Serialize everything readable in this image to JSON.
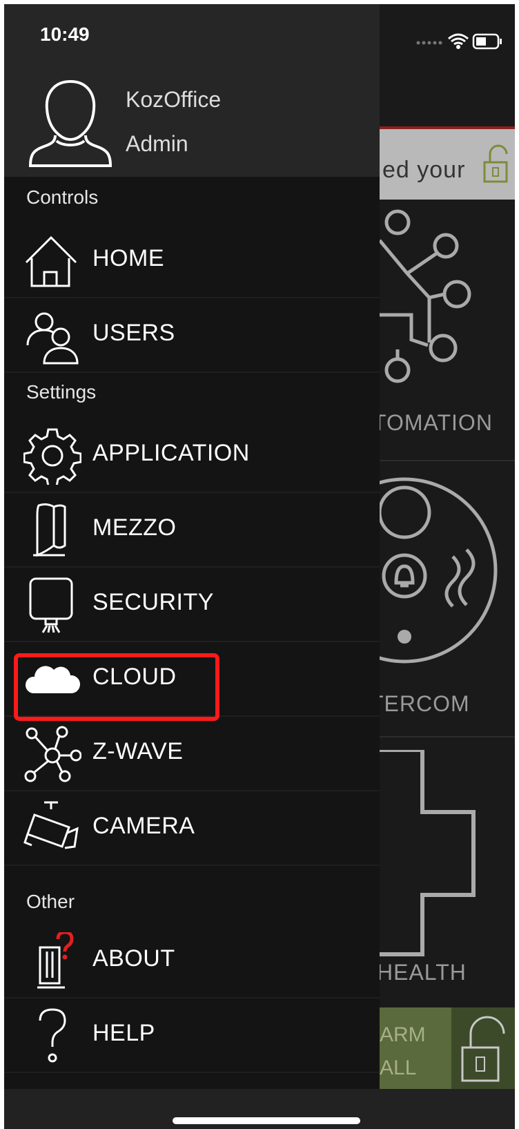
{
  "status_bar": {
    "time": "10:49"
  },
  "user": {
    "name": "KozOffice",
    "role": "Admin"
  },
  "sections": {
    "controls": "Controls",
    "settings": "Settings",
    "other": "Other"
  },
  "menu": {
    "home": "HOME",
    "users": "USERS",
    "application": "APPLICATION",
    "mezzo": "MEZZO",
    "security": "SECURITY",
    "cloud": "CLOUD",
    "zwave": "Z-WAVE",
    "camera": "CAMERA",
    "about": "ABOUT",
    "help": "HELP"
  },
  "background": {
    "banner_text": "ed your",
    "tiles": [
      "TOMATION",
      "TERCOM",
      "HEALTH"
    ],
    "arm_line1": "ARM",
    "arm_line2": "ALL"
  },
  "icons": {
    "avatar": "user-avatar-icon",
    "home": "house-icon",
    "users": "people-icon",
    "application": "gear-icon",
    "mezzo": "mezzo-device-icon",
    "security": "security-sensor-icon",
    "cloud": "cloud-icon",
    "zwave": "network-nodes-icon",
    "camera": "camera-icon",
    "about": "about-device-icon",
    "help": "question-icon"
  },
  "colors": {
    "highlight": "#ff1a1a",
    "drawer_bg": "#141414",
    "header_bg": "#262626"
  }
}
